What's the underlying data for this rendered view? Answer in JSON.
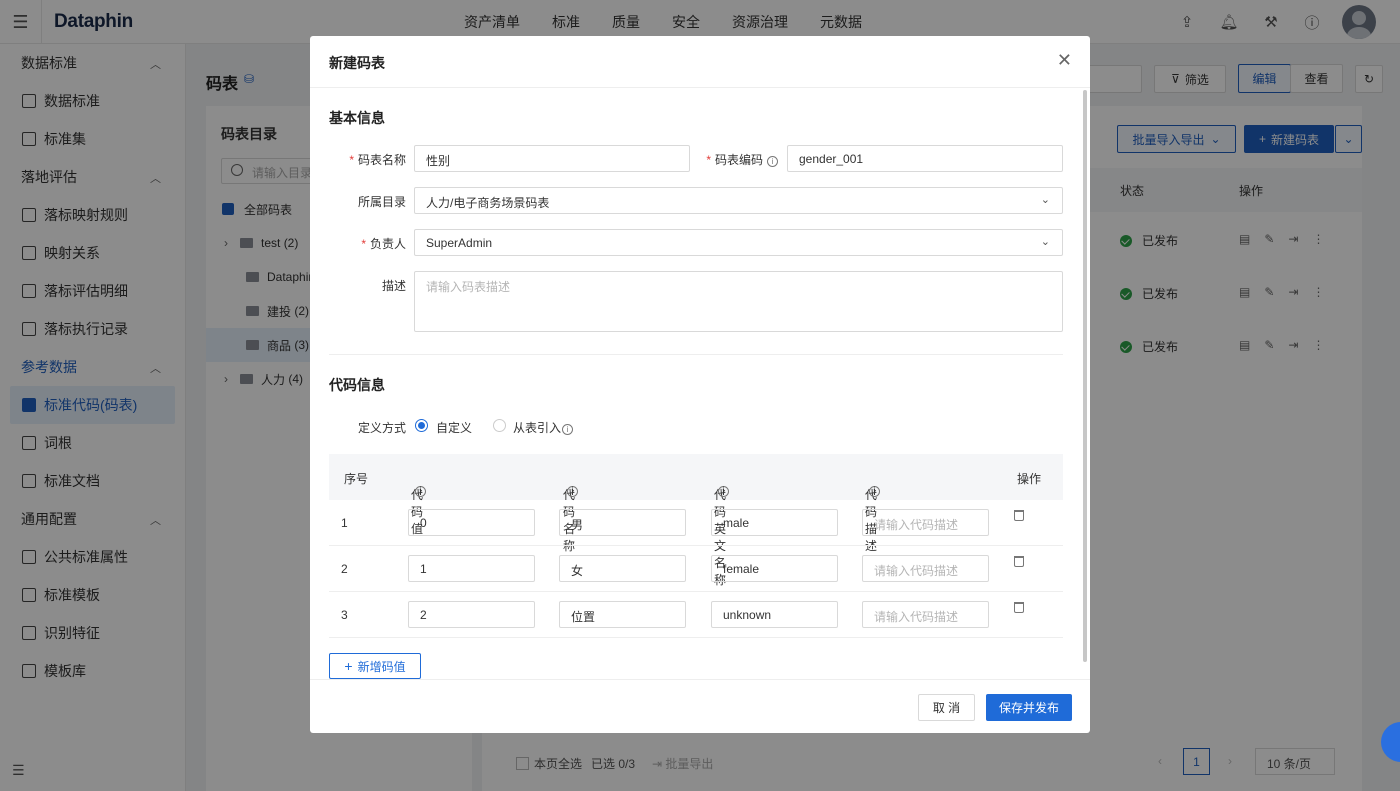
{
  "app": {
    "logo": "Dataphin",
    "menu_icon": "hamburger-icon"
  },
  "topnav": [
    "资产清单",
    "标准",
    "质量",
    "安全",
    "资源治理",
    "元数据"
  ],
  "sidebar": {
    "groups": [
      {
        "label": "数据标准",
        "items": [
          "数据标准",
          "标准集"
        ]
      },
      {
        "label": "落地评估",
        "items": [
          "落标映射规则",
          "映射关系",
          "落标评估明细",
          "落标执行记录"
        ]
      },
      {
        "label": "参考数据",
        "items": [
          "标准代码(码表)",
          "词根",
          "标准文档"
        ]
      },
      {
        "label": "通用配置",
        "items": [
          "公共标准属性",
          "标准模板",
          "识别特征",
          "模板库"
        ]
      }
    ],
    "active": "标准代码(码表)"
  },
  "page": {
    "title": "码表",
    "tree_title": "码表目录",
    "tree_search_placeholder": "请输入目录",
    "tree": [
      {
        "label": "全部码表",
        "count": ""
      },
      {
        "label": "test",
        "count": "(2)"
      },
      {
        "label": "Dataphin",
        "count": ""
      },
      {
        "label": "建投",
        "count": "(2)"
      },
      {
        "label": "商品",
        "count": "(3)"
      },
      {
        "label": "人力",
        "count": "(4)"
      }
    ],
    "toolbar": {
      "filter": "筛选",
      "edit": "编辑",
      "view": "查看",
      "batch": "批量导入导出",
      "new": "新建码表"
    },
    "table_headers": {
      "status": "状态",
      "ops": "操作"
    },
    "rows_status": [
      "已发布",
      "已发布",
      "已发布"
    ],
    "footer": {
      "select_all": "本页全选",
      "selected": "已选 0/3",
      "batch_export": "批量导出",
      "page": "1",
      "page_size": "10 条/页"
    }
  },
  "modal": {
    "title": "新建码表",
    "basic_title": "基本信息",
    "name_label": "码表名称",
    "name_value": "性别",
    "code_label": "码表编码",
    "code_value": "gender_001",
    "dir_label": "所属目录",
    "dir_value": "人力/电子商务场景码表",
    "owner_label": "负责人",
    "owner_value": "SuperAdmin",
    "desc_label": "描述",
    "desc_placeholder": "请输入码表描述",
    "code_info_title": "代码信息",
    "define_label": "定义方式",
    "define_custom": "自定义",
    "define_import": "从表引入",
    "columns": {
      "idx": "序号",
      "value": "代码值",
      "name": "代码名称",
      "en_name": "代码英文名称",
      "desc": "代码描述",
      "ops": "操作"
    },
    "rows": [
      {
        "idx": "1",
        "value": "0",
        "name": "男",
        "en_name": "male"
      },
      {
        "idx": "2",
        "value": "1",
        "name": "女",
        "en_name": "female"
      },
      {
        "idx": "3",
        "value": "2",
        "name": "位置",
        "en_name": "unknown"
      }
    ],
    "desc_cell_placeholder": "请输入代码描述",
    "add_button": "新增码值",
    "cancel_button": "取 消",
    "save_button": "保存并发布"
  },
  "colors": {
    "primary": "#1f6bd8",
    "success": "#2fa34a",
    "required": "#e23c39"
  }
}
